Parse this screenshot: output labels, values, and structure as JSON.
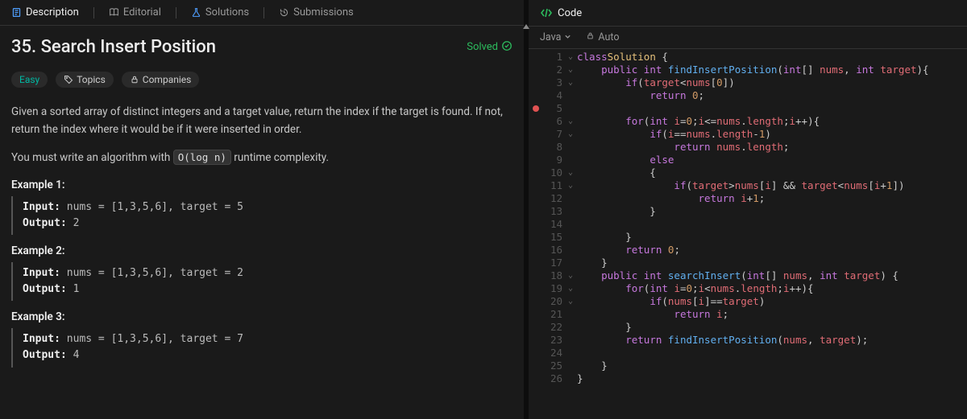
{
  "left": {
    "tabs": {
      "description": "Description",
      "editorial": "Editorial",
      "solutions": "Solutions",
      "submissions": "Submissions"
    },
    "title": "35. Search Insert Position",
    "solved_label": "Solved",
    "chips": {
      "difficulty": "Easy",
      "topics": "Topics",
      "companies": "Companies"
    },
    "desc1": "Given a sorted array of distinct integers and a target value, return the index if the target is found. If not, return the index where it would be if it were inserted in order.",
    "desc2a": "You must write an algorithm with ",
    "desc2_code": "O(log n)",
    "desc2b": " runtime complexity.",
    "examples": [
      {
        "title": "Example 1:",
        "input": "Input: nums = [1,3,5,6], target = 5",
        "output": "Output: 2"
      },
      {
        "title": "Example 2:",
        "input": "Input: nums = [1,3,5,6], target = 2",
        "output": "Output: 1"
      },
      {
        "title": "Example 3:",
        "input": "Input: nums = [1,3,5,6], target = 7",
        "output": "Output: 4"
      }
    ]
  },
  "right": {
    "title": "Code",
    "lang": "Java",
    "auto": "Auto"
  },
  "code": {
    "foldable": [
      1,
      2,
      3,
      6,
      7,
      10,
      11,
      18,
      19,
      20
    ],
    "breakpoint": 5,
    "lines": [
      [
        [
          "kw",
          "class"
        ],
        [
          "",
          ""
        ],
        [
          "ty",
          "Solution"
        ],
        [
          "",
          " {"
        ]
      ],
      [
        [
          "",
          "    "
        ],
        [
          "kw",
          "public"
        ],
        [
          "",
          " "
        ],
        [
          "kw",
          "int"
        ],
        [
          "",
          " "
        ],
        [
          "fn",
          "findInsertPosition"
        ],
        [
          "",
          "("
        ],
        [
          "kw",
          "int"
        ],
        [
          "",
          "[] "
        ],
        [
          "id",
          "nums"
        ],
        [
          "",
          ", "
        ],
        [
          "kw",
          "int"
        ],
        [
          "",
          " "
        ],
        [
          "id",
          "target"
        ],
        [
          "",
          "){"
        ]
      ],
      [
        [
          "",
          "        "
        ],
        [
          "kw",
          "if"
        ],
        [
          "",
          "("
        ],
        [
          "id",
          "target"
        ],
        [
          "",
          "<"
        ],
        [
          "id",
          "nums"
        ],
        [
          "",
          "["
        ],
        [
          "nm",
          "0"
        ],
        [
          "",
          "])"
        ]
      ],
      [
        [
          "",
          "            "
        ],
        [
          "kw",
          "return"
        ],
        [
          "",
          " "
        ],
        [
          "nm",
          "0"
        ],
        [
          "",
          ";"
        ]
      ],
      [
        [
          "",
          ""
        ]
      ],
      [
        [
          "",
          "        "
        ],
        [
          "kw",
          "for"
        ],
        [
          "",
          "("
        ],
        [
          "kw",
          "int"
        ],
        [
          "",
          " "
        ],
        [
          "id",
          "i"
        ],
        [
          "",
          "="
        ],
        [
          "nm",
          "0"
        ],
        [
          "",
          ";"
        ],
        [
          "id",
          "i"
        ],
        [
          "",
          "<="
        ],
        [
          "id",
          "nums"
        ],
        [
          "",
          "."
        ],
        [
          "id",
          "length"
        ],
        [
          "",
          ";"
        ],
        [
          "id",
          "i"
        ],
        [
          "",
          "++){"
        ]
      ],
      [
        [
          "",
          "            "
        ],
        [
          "kw",
          "if"
        ],
        [
          "",
          "("
        ],
        [
          "id",
          "i"
        ],
        [
          "",
          "=="
        ],
        [
          "id",
          "nums"
        ],
        [
          "",
          "."
        ],
        [
          "id",
          "length"
        ],
        [
          "",
          "-"
        ],
        [
          "nm",
          "1"
        ],
        [
          "",
          ")"
        ]
      ],
      [
        [
          "",
          "                "
        ],
        [
          "kw",
          "return"
        ],
        [
          "",
          " "
        ],
        [
          "id",
          "nums"
        ],
        [
          "",
          "."
        ],
        [
          "id",
          "length"
        ],
        [
          "",
          ";"
        ]
      ],
      [
        [
          "",
          "            "
        ],
        [
          "kw",
          "else"
        ]
      ],
      [
        [
          "",
          "            {"
        ]
      ],
      [
        [
          "",
          "                "
        ],
        [
          "kw",
          "if"
        ],
        [
          "",
          "("
        ],
        [
          "id",
          "target"
        ],
        [
          "",
          ">"
        ],
        [
          "id",
          "nums"
        ],
        [
          "",
          "["
        ],
        [
          "id",
          "i"
        ],
        [
          "",
          "] && "
        ],
        [
          "id",
          "target"
        ],
        [
          "",
          "<"
        ],
        [
          "id",
          "nums"
        ],
        [
          "",
          "["
        ],
        [
          "id",
          "i"
        ],
        [
          "",
          "+"
        ],
        [
          "nm",
          "1"
        ],
        [
          "",
          "])"
        ]
      ],
      [
        [
          "",
          "                    "
        ],
        [
          "kw",
          "return"
        ],
        [
          "",
          " "
        ],
        [
          "id",
          "i"
        ],
        [
          "",
          "+"
        ],
        [
          "nm",
          "1"
        ],
        [
          "",
          ";"
        ]
      ],
      [
        [
          "",
          "            }"
        ]
      ],
      [
        [
          "",
          ""
        ]
      ],
      [
        [
          "",
          "        }"
        ]
      ],
      [
        [
          "",
          "        "
        ],
        [
          "kw",
          "return"
        ],
        [
          "",
          " "
        ],
        [
          "nm",
          "0"
        ],
        [
          "",
          ";"
        ]
      ],
      [
        [
          "",
          "    }"
        ]
      ],
      [
        [
          "",
          "    "
        ],
        [
          "kw",
          "public"
        ],
        [
          "",
          " "
        ],
        [
          "kw",
          "int"
        ],
        [
          "",
          " "
        ],
        [
          "fn",
          "searchInsert"
        ],
        [
          "",
          "("
        ],
        [
          "kw",
          "int"
        ],
        [
          "",
          "[] "
        ],
        [
          "id",
          "nums"
        ],
        [
          "",
          ", "
        ],
        [
          "kw",
          "int"
        ],
        [
          "",
          " "
        ],
        [
          "id",
          "target"
        ],
        [
          "",
          ") {"
        ]
      ],
      [
        [
          "",
          "        "
        ],
        [
          "kw",
          "for"
        ],
        [
          "",
          "("
        ],
        [
          "kw",
          "int"
        ],
        [
          "",
          " "
        ],
        [
          "id",
          "i"
        ],
        [
          "",
          "="
        ],
        [
          "nm",
          "0"
        ],
        [
          "",
          ";"
        ],
        [
          "id",
          "i"
        ],
        [
          "",
          "<"
        ],
        [
          "id",
          "nums"
        ],
        [
          "",
          "."
        ],
        [
          "id",
          "length"
        ],
        [
          "",
          ";"
        ],
        [
          "id",
          "i"
        ],
        [
          "",
          "++){"
        ]
      ],
      [
        [
          "",
          "            "
        ],
        [
          "kw",
          "if"
        ],
        [
          "",
          "("
        ],
        [
          "id",
          "nums"
        ],
        [
          "",
          "["
        ],
        [
          "id",
          "i"
        ],
        [
          "",
          "]=="
        ],
        [
          "id",
          "target"
        ],
        [
          "",
          ")"
        ]
      ],
      [
        [
          "",
          "                "
        ],
        [
          "kw",
          "return"
        ],
        [
          "",
          " "
        ],
        [
          "id",
          "i"
        ],
        [
          "",
          ";"
        ]
      ],
      [
        [
          "",
          "        }"
        ]
      ],
      [
        [
          "",
          "        "
        ],
        [
          "kw",
          "return"
        ],
        [
          "",
          " "
        ],
        [
          "fn",
          "findInsertPosition"
        ],
        [
          "",
          "("
        ],
        [
          "id",
          "nums"
        ],
        [
          "",
          ", "
        ],
        [
          "id",
          "target"
        ],
        [
          "",
          ");"
        ]
      ],
      [
        [
          "",
          ""
        ]
      ],
      [
        [
          "",
          "    }"
        ]
      ],
      [
        [
          "",
          "}"
        ]
      ]
    ]
  }
}
